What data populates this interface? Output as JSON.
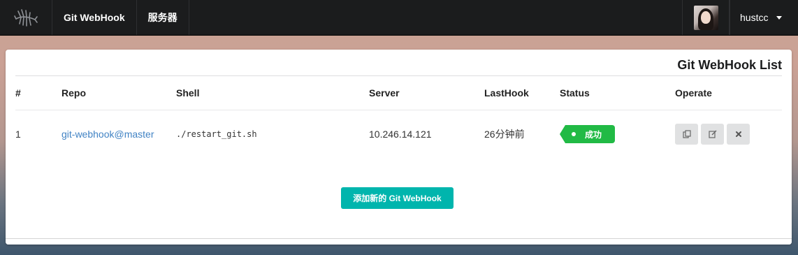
{
  "navbar": {
    "logo_icon": "fish-skeleton-logo-icon",
    "items": [
      {
        "label": "Git WebHook"
      },
      {
        "label": "服务器"
      }
    ],
    "user": {
      "name": "hustcc",
      "avatar_icon": "user-avatar"
    }
  },
  "card": {
    "title": "Git WebHook List",
    "columns": [
      "#",
      "Repo",
      "Shell",
      "Server",
      "LastHook",
      "Status",
      "Operate"
    ],
    "rows": [
      {
        "index": "1",
        "repo": "git-webhook@master",
        "shell": "./restart_git.sh",
        "server": "10.246.14.121",
        "last_hook": "26分钟前",
        "status": "成功",
        "operations": [
          "copy-icon",
          "edit-icon",
          "delete-icon"
        ]
      }
    ],
    "add_button": "添加新的 Git WebHook"
  },
  "colors": {
    "navbar_bg": "#1b1c1d",
    "status_success": "#21ba45",
    "add_button": "#00b5ad",
    "link": "#4183c4"
  }
}
